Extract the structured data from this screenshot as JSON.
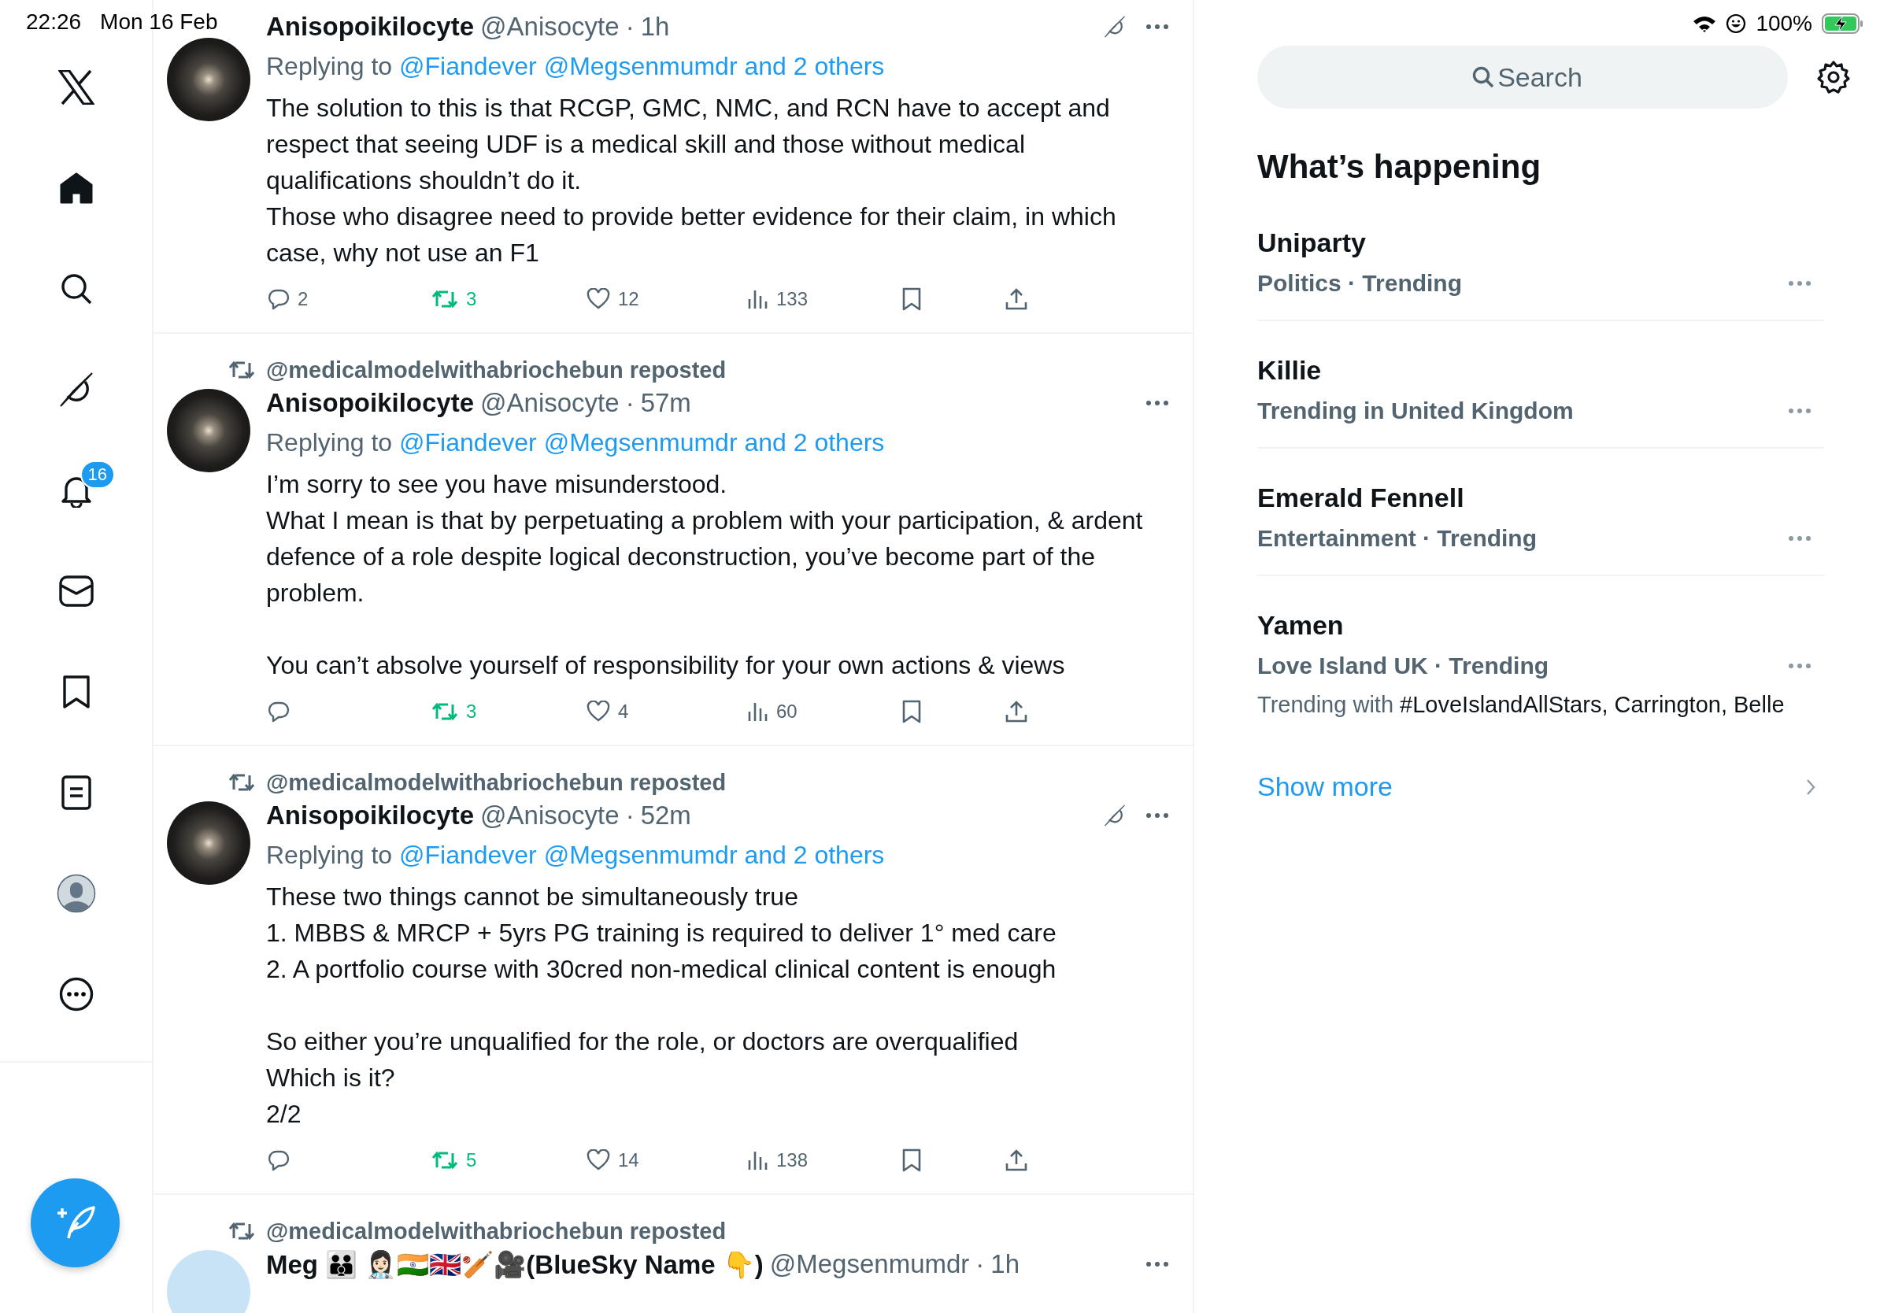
{
  "status_bar": {
    "time": "22:26",
    "date": "Mon 16 Feb",
    "battery": "100%"
  },
  "sidebar": {
    "items": [
      {
        "kind": "logo",
        "selected": false
      },
      {
        "kind": "home",
        "selected": true
      },
      {
        "kind": "search",
        "selected": false
      },
      {
        "kind": "grok",
        "selected": false
      },
      {
        "kind": "notifications",
        "selected": false,
        "badge": "16"
      },
      {
        "kind": "messages",
        "selected": false
      },
      {
        "kind": "bookmarks",
        "selected": false
      },
      {
        "kind": "lists",
        "selected": false
      },
      {
        "kind": "profile",
        "selected": false
      },
      {
        "kind": "more",
        "selected": false
      }
    ]
  },
  "feed": {
    "tweets": [
      {
        "name": "Anisopoikilocyte",
        "handle": "@Anisocyte",
        "sep": "·",
        "time": "1h",
        "avatar_photo": true,
        "grok": true,
        "replying_label": "Replying to",
        "replying_to": [
          "@Fiandever",
          "@Megsenmumdr",
          "and 2 others"
        ],
        "blocks": [
          [
            "The solution to this is that RCGP, GMC, NMC, and RCN have to accept and respect that seeing UDF is a medical skill and those without medical qualifications shouldn’t do it.",
            "Those who disagree need to provide better evidence for their claim, in which case, why not use an F1"
          ]
        ],
        "replies": "2",
        "reposts": "3",
        "retweeted": true,
        "likes": "12",
        "liked": false,
        "views": "133"
      },
      {
        "repost_by": "@medicalmodelwithabriochebun reposted",
        "name": "Anisopoikilocyte",
        "handle": "@Anisocyte",
        "sep": "·",
        "time": "57m",
        "avatar_photo": true,
        "grok": false,
        "replying_label": "Replying to",
        "replying_to": [
          "@Fiandever",
          "@Megsenmumdr",
          "and 2 others"
        ],
        "blocks": [
          [
            "I’m sorry to see you have misunderstood.",
            "What I mean is that by perpetuating a problem with your participation, & ardent defence of a role despite logical deconstruction, you’ve become part of the problem."
          ],
          [
            "You can’t absolve yourself of responsibility for your own actions & views"
          ]
        ],
        "reposts": "3",
        "retweeted": true,
        "likes": "4",
        "liked": false,
        "views": "60"
      },
      {
        "repost_by": "@medicalmodelwithabriochebun reposted",
        "name": "Anisopoikilocyte",
        "handle": "@Anisocyte",
        "sep": "·",
        "time": "52m",
        "avatar_photo": true,
        "grok": true,
        "replying_label": "Replying to",
        "replying_to": [
          "@Fiandever",
          "@Megsenmumdr",
          "and 2 others"
        ],
        "blocks": [
          [
            "These two things cannot be simultaneously true",
            "1. MBBS & MRCP + 5yrs PG training is required to deliver 1° med care",
            "2. A portfolio course with 30cred non-medical clinical content is enough"
          ],
          [
            "So either you’re unqualified for the role, or doctors are overqualified",
            "Which is it?",
            "2/2"
          ]
        ],
        "reposts": "5",
        "retweeted": true,
        "likes": "14",
        "liked": false,
        "views": "138"
      },
      {
        "repost_by": "@medicalmodelwithabriochebun reposted",
        "name": "Meg 👪 👩🏻‍⚕️🇮🇳🇬🇧🏏🎥(BlueSky Name 👇)",
        "handle": "@Megsenmumdr",
        "sep": "·",
        "time": "1h",
        "avatar_photo": false,
        "grok": false
      }
    ]
  },
  "right": {
    "search": {
      "placeholder": "Search"
    },
    "heading": "What’s happening",
    "trends": [
      {
        "title": "Uniparty",
        "meta": "Politics · Trending"
      },
      {
        "title": "Killie",
        "meta": "Trending in United Kingdom"
      },
      {
        "title": "Emerald Fennell",
        "meta": "Entertainment · Trending"
      },
      {
        "title": "Yamen",
        "meta": "Love Island UK · Trending",
        "context_label": "Trending with",
        "context_items": "#LoveIslandAllStars, Carrington, Belle"
      }
    ],
    "show_more": "Show more"
  }
}
